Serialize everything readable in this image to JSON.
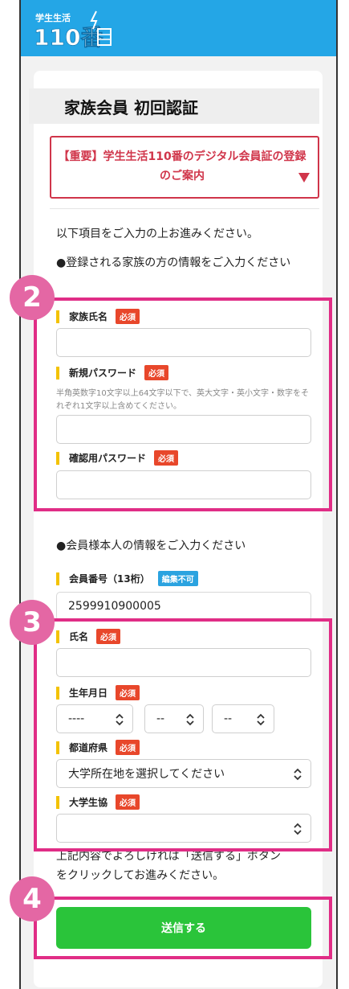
{
  "header": {
    "logo_top": "学生生活",
    "logo_main": "110番"
  },
  "page": {
    "title": "家族会員 初回認証",
    "notice": "【重要】学生生活110番のデジタル会員証の登録のご案内",
    "intro": "以下項目をご入力の上お進みください。"
  },
  "family": {
    "heading": "●登録される家族の方の情報をご入力ください",
    "name_label": "家族氏名",
    "password_label": "新規パスワード",
    "password_hint": "半角英数字10文字以上64文字以下で、英大文字・英小文字・数字をそれぞれ1文字以上含めてください。",
    "confirm_label": "確認用パスワード",
    "required": "必須"
  },
  "member": {
    "heading": "●会員様本人の情報をご入力ください",
    "number_label": "会員番号（13桁）",
    "not_editable": "編集不可",
    "number_value": "2599910900005",
    "name_label": "氏名",
    "birth_label": "生年月日",
    "birth_year": "----",
    "birth_month": "--",
    "birth_day": "--",
    "pref_label": "都道府県",
    "pref_value": "大学所在地を選択してください",
    "coop_label": "大学生協",
    "coop_value": "",
    "required": "必須"
  },
  "confirm_text_1": "上記内容でよろしければ「送信する」ボタン",
  "confirm_text_2": "をクリックしてお進みください。",
  "submit_label": "送信する",
  "steps": [
    "2",
    "3",
    "4"
  ],
  "colors": {
    "header": "#24a6e6",
    "highlight": "#e02d86",
    "step_badge": "#e467a4",
    "submit": "#2ac43a",
    "required_badge": "#e8472b",
    "notice": "#d0354a"
  }
}
